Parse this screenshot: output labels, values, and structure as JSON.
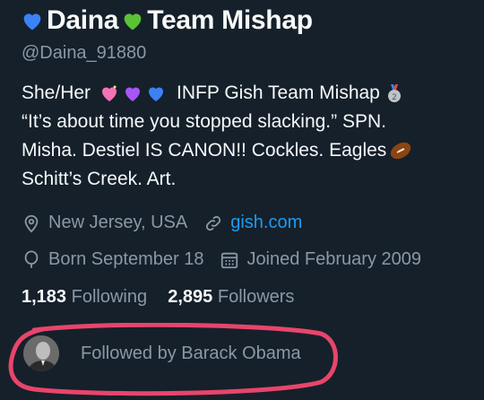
{
  "profile": {
    "name_part1": "Daina",
    "name_part2": "Team Mishap",
    "handle": "@Daina_91880",
    "bio_line1_a": "She/Her",
    "bio_line1_b": "INFP Gish Team Mishap",
    "bio_line2": "“It’s about time you stopped slacking.” SPN.",
    "bio_line3": "Misha. Destiel IS CANON!! Cockles. Eagles",
    "bio_line4": "Schitt’s Creek. Art.",
    "location": "New Jersey, USA",
    "website": "gish.com",
    "birthday": "Born September 18",
    "joined": "Joined February 2009",
    "following_count": "1,183",
    "following_label": "Following",
    "followers_count": "2,895",
    "followers_label": "Followers",
    "followed_by": "Followed by Barack Obama"
  },
  "colors": {
    "background": "#15202b",
    "primary_text": "#f7f9f9",
    "secondary_text": "#8b98a5",
    "link": "#1d9bf0",
    "annotation_circle": "#e8456b"
  },
  "icons": [
    "blue-heart-icon",
    "green-heart-icon",
    "pink-sparkle-heart-icon",
    "purple-heart-icon",
    "blue-heart-icon",
    "second-place-medal-icon",
    "football-icon",
    "location-pin-icon",
    "link-icon",
    "balloon-icon",
    "calendar-icon"
  ]
}
